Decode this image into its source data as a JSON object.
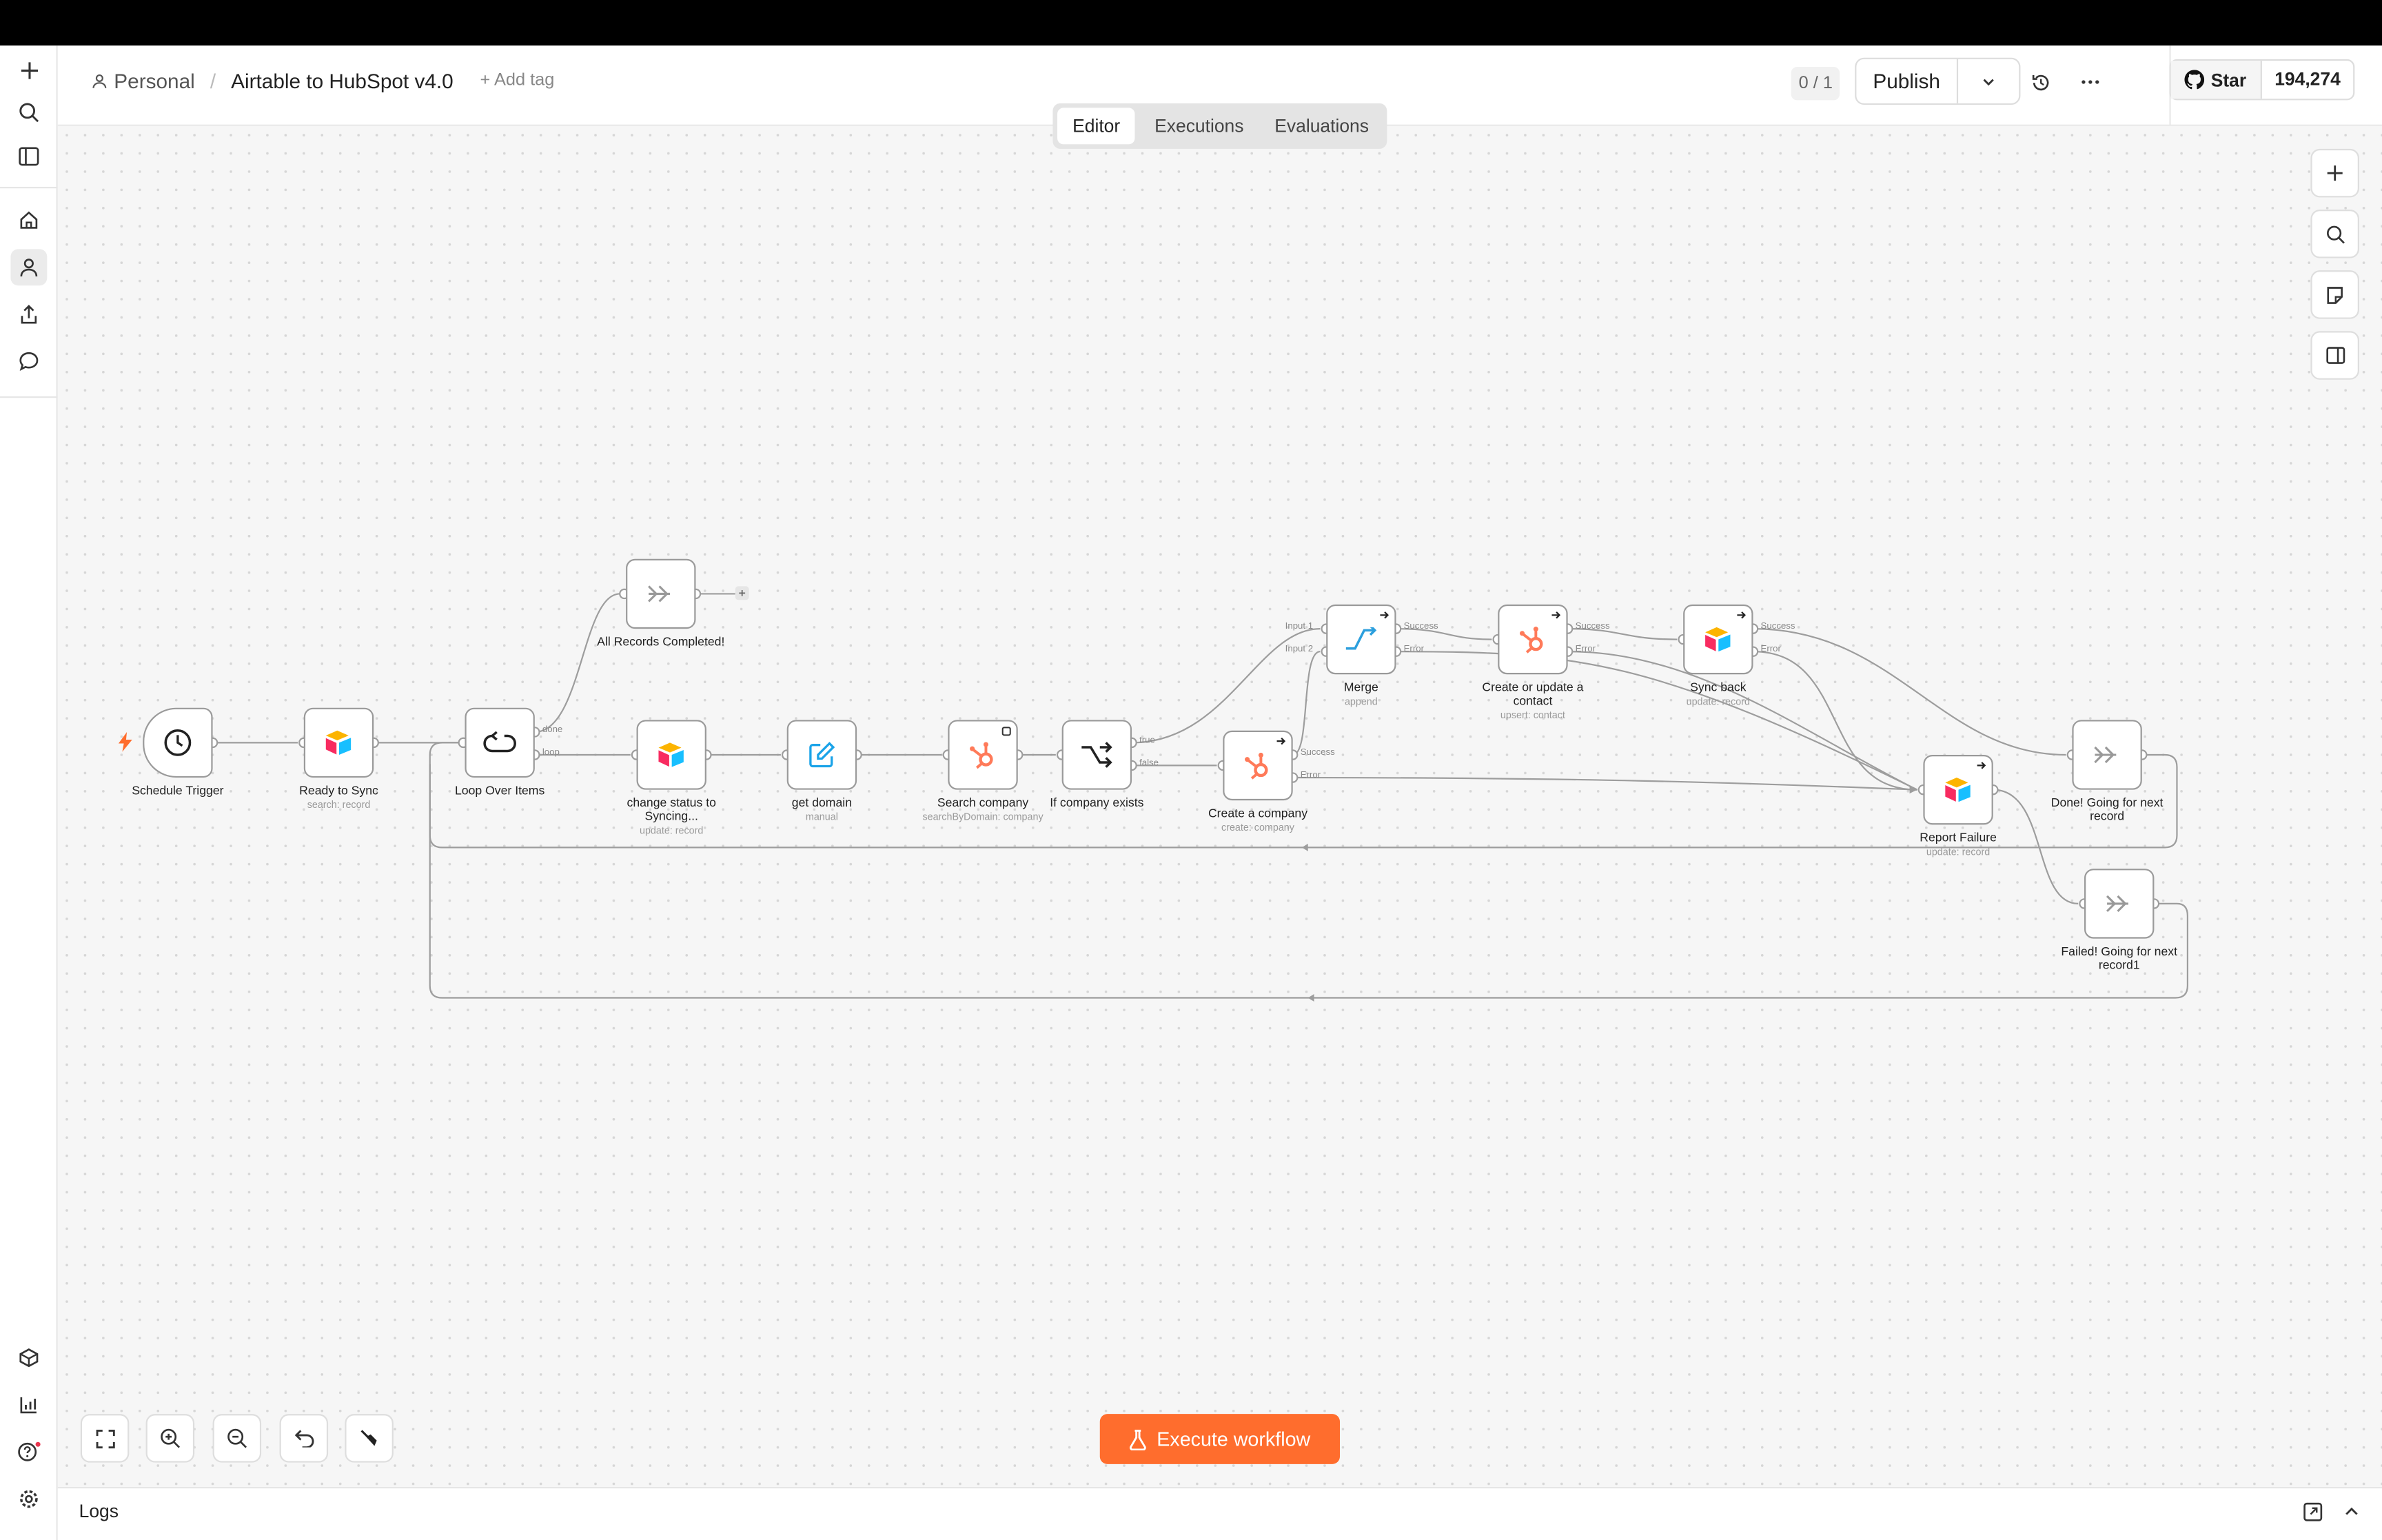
{
  "header": {
    "breadcrumb_owner": "Personal",
    "breadcrumb_sep": "/",
    "workflow_name": "Airtable to HubSpot v4.0",
    "add_tag": "+ Add tag",
    "version_badge": "0 / 1",
    "publish_label": "Publish",
    "github_star": "Star",
    "github_count": "194,274"
  },
  "tabs": [
    "Editor",
    "Executions",
    "Evaluations"
  ],
  "active_tab": "Editor",
  "nodes": {
    "schedule_trigger": {
      "label": "Schedule Trigger"
    },
    "ready_to_sync": {
      "label": "Ready to Sync",
      "sub": "search: record"
    },
    "loop_over_items": {
      "label": "Loop Over Items",
      "done": "done",
      "loop": "loop"
    },
    "all_records_completed": {
      "label": "All Records Completed!",
      "plus": "+"
    },
    "change_status": {
      "label1": "change status to",
      "label2": "Syncing...",
      "sub": "update: record"
    },
    "get_domain": {
      "label": "get domain",
      "sub": "manual"
    },
    "search_company": {
      "label": "Search company",
      "sub": "searchByDomain: company"
    },
    "if_company_exists": {
      "label": "If company exists",
      "true": "true",
      "false": "false"
    },
    "create_company": {
      "label": "Create a company",
      "sub": "create: company",
      "success": "Success",
      "error": "Error"
    },
    "merge": {
      "label": "Merge",
      "sub": "append",
      "input1": "Input 1",
      "input2": "Input 2",
      "success": "Success",
      "error": "Error"
    },
    "create_update_contact": {
      "label1": "Create or update a",
      "label2": "contact",
      "sub": "upsert: contact",
      "success": "Success",
      "error": "Error"
    },
    "sync_back": {
      "label": "Sync back",
      "sub": "update: record",
      "success": "Success",
      "error": "Error"
    },
    "report_failure": {
      "label": "Report Failure",
      "sub": "update: record"
    },
    "done_next": {
      "label1": "Done! Going for next",
      "label2": "record"
    },
    "failed_next": {
      "label1": "Failed! Going for next",
      "label2": "record1"
    }
  },
  "execute_button": "Execute workflow",
  "logs_label": "Logs",
  "colors": {
    "accent": "#ff6d2d",
    "hubspot": "#ff7a59",
    "edit_icon": "#1aa3e8",
    "merge_icon": "#2c9fdd"
  }
}
